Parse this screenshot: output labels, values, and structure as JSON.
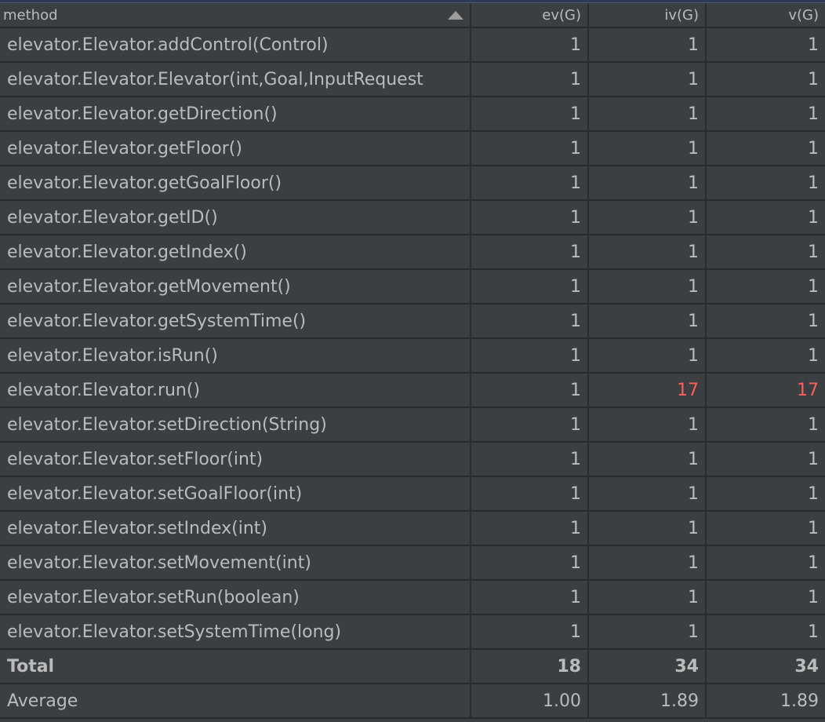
{
  "header": {
    "method": "method",
    "ev": "ev(G)",
    "iv": "iv(G)",
    "v": "v(G)"
  },
  "rows": [
    {
      "method": "elevator.Elevator.addControl(Control)",
      "ev": "1",
      "iv": "1",
      "v": "1"
    },
    {
      "method": "elevator.Elevator.Elevator(int,Goal,InputRequest",
      "ev": "1",
      "iv": "1",
      "v": "1"
    },
    {
      "method": "elevator.Elevator.getDirection()",
      "ev": "1",
      "iv": "1",
      "v": "1"
    },
    {
      "method": "elevator.Elevator.getFloor()",
      "ev": "1",
      "iv": "1",
      "v": "1"
    },
    {
      "method": "elevator.Elevator.getGoalFloor()",
      "ev": "1",
      "iv": "1",
      "v": "1"
    },
    {
      "method": "elevator.Elevator.getID()",
      "ev": "1",
      "iv": "1",
      "v": "1"
    },
    {
      "method": "elevator.Elevator.getIndex()",
      "ev": "1",
      "iv": "1",
      "v": "1"
    },
    {
      "method": "elevator.Elevator.getMovement()",
      "ev": "1",
      "iv": "1",
      "v": "1"
    },
    {
      "method": "elevator.Elevator.getSystemTime()",
      "ev": "1",
      "iv": "1",
      "v": "1"
    },
    {
      "method": "elevator.Elevator.isRun()",
      "ev": "1",
      "iv": "1",
      "v": "1"
    },
    {
      "method": "elevator.Elevator.run()",
      "ev": "1",
      "iv": "17",
      "v": "17"
    },
    {
      "method": "elevator.Elevator.setDirection(String)",
      "ev": "1",
      "iv": "1",
      "v": "1"
    },
    {
      "method": "elevator.Elevator.setFloor(int)",
      "ev": "1",
      "iv": "1",
      "v": "1"
    },
    {
      "method": "elevator.Elevator.setGoalFloor(int)",
      "ev": "1",
      "iv": "1",
      "v": "1"
    },
    {
      "method": "elevator.Elevator.setIndex(int)",
      "ev": "1",
      "iv": "1",
      "v": "1"
    },
    {
      "method": "elevator.Elevator.setMovement(int)",
      "ev": "1",
      "iv": "1",
      "v": "1"
    },
    {
      "method": "elevator.Elevator.setRun(boolean)",
      "ev": "1",
      "iv": "1",
      "v": "1"
    },
    {
      "method": "elevator.Elevator.setSystemTime(long)",
      "ev": "1",
      "iv": "1",
      "v": "1"
    }
  ],
  "total": {
    "method": "Total",
    "ev": "18",
    "iv": "34",
    "v": "34"
  },
  "average": {
    "method": "Average",
    "ev": "1.00",
    "iv": "1.89",
    "v": "1.89"
  },
  "colors": {
    "background": "#3c3f41",
    "grid": "#2b2b2b",
    "text": "#bbbbbb",
    "highlight": "#ff5f5a"
  },
  "icons": {
    "sort": "sort-ascending-icon"
  }
}
